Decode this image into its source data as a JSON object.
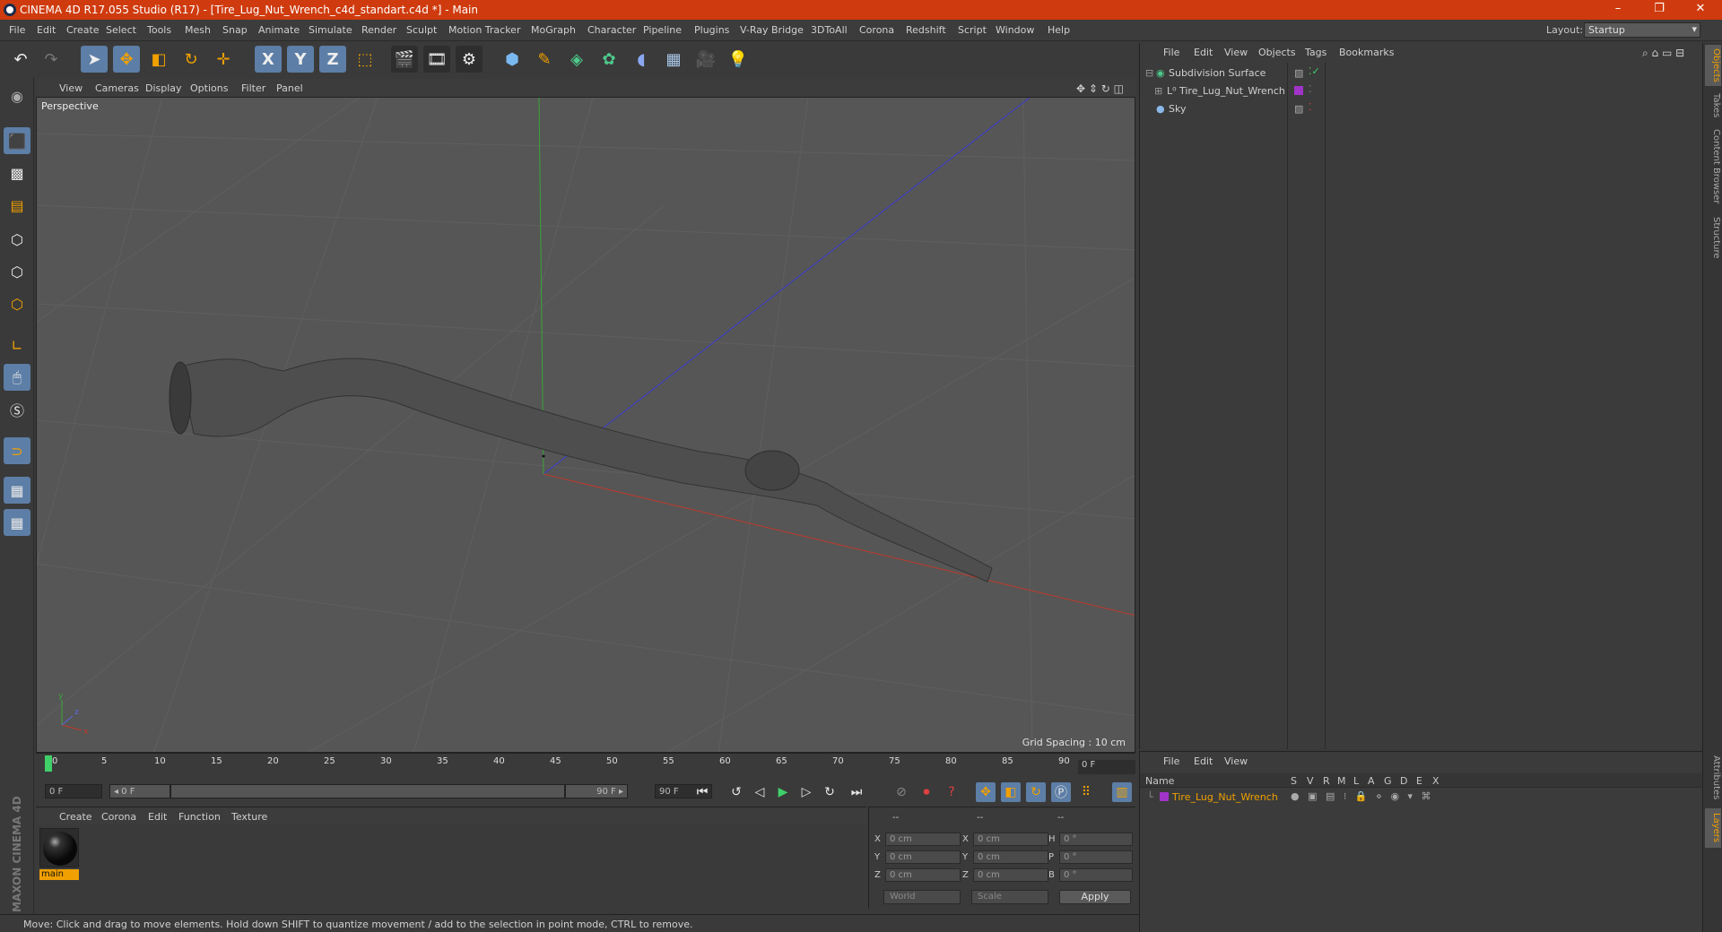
{
  "window": {
    "title": "CINEMA 4D R17.055 Studio (R17) - [Tire_Lug_Nut_Wrench_c4d_standart.c4d *] - Main",
    "controls": [
      "–",
      "❐",
      "✕"
    ]
  },
  "menubar": {
    "items": [
      "File",
      "Edit",
      "Create",
      "Select",
      "Tools",
      "Mesh",
      "Snap",
      "Animate",
      "Simulate",
      "Render",
      "Sculpt",
      "Motion Tracker",
      "MoGraph",
      "Character",
      "Pipeline",
      "Plugins",
      "V-Ray Bridge",
      "3DToAll",
      "Corona",
      "Redshift",
      "Script",
      "Window",
      "Help"
    ],
    "layout_label": "Layout:",
    "layout_value": "Startup"
  },
  "toolbar": {
    "icons": [
      "undo-icon",
      "redo-icon",
      "select-arrow-icon",
      "move-icon",
      "scale-icon",
      "rotate-icon",
      "live-select-icon",
      "x-axis-icon",
      "y-axis-icon",
      "z-axis-icon",
      "coordinate-system-icon",
      "render-view-icon",
      "render-picture-viewer-icon",
      "render-settings-icon",
      "cube-icon",
      "pen-icon",
      "subdivision-icon",
      "cloner-icon",
      "deformer-icon",
      "floor-icon",
      "camera-icon",
      "light-icon"
    ],
    "axis_x": "X",
    "axis_y": "Y",
    "axis_z": "Z"
  },
  "viewport": {
    "menu": [
      "View",
      "Cameras",
      "Display",
      "Options",
      "Filter",
      "Panel"
    ],
    "label": "Perspective",
    "grid_spacing": "Grid Spacing : 10 cm",
    "axis_colors": {
      "x": "#c0392b",
      "y": "#3aa53a",
      "z": "#3b3bd0"
    }
  },
  "timeline": {
    "ticks": [
      "0",
      "5",
      "10",
      "15",
      "20",
      "25",
      "30",
      "35",
      "40",
      "45",
      "50",
      "55",
      "60",
      "65",
      "70",
      "75",
      "80",
      "85",
      "90"
    ],
    "current_frame": "0 F"
  },
  "transport": {
    "start_field": "0 F",
    "range_left": "◂ 0 F",
    "range_right": "90 F ▸",
    "end_field": "90 F"
  },
  "material_manager": {
    "menu": [
      "Create",
      "Corona",
      "Edit",
      "Function",
      "Texture"
    ],
    "materials": [
      {
        "name": "main"
      }
    ]
  },
  "coordinates": {
    "headers": [
      "--",
      "--",
      "--"
    ],
    "rows": [
      {
        "axis": "X",
        "pos": "0 cm",
        "axis2": "X",
        "size": "0 cm",
        "rot_label": "H",
        "rot": "0 °"
      },
      {
        "axis": "Y",
        "pos": "0 cm",
        "axis2": "Y",
        "size": "0 cm",
        "rot_label": "P",
        "rot": "0 °"
      },
      {
        "axis": "Z",
        "pos": "0 cm",
        "axis2": "Z",
        "size": "0 cm",
        "rot_label": "B",
        "rot": "0 °"
      }
    ],
    "mode1": "World",
    "mode2": "Scale",
    "apply": "Apply"
  },
  "statusbar": {
    "text": "Move: Click and drag to move elements. Hold down SHIFT to quantize movement / add to the selection in point mode, CTRL to remove."
  },
  "object_manager": {
    "menu": [
      "File",
      "Edit",
      "View",
      "Objects",
      "Tags",
      "Bookmarks"
    ],
    "objects": [
      {
        "name": "Subdivision Surface",
        "icon": "subdivision-icon"
      },
      {
        "name": "Tire_Lug_Nut_Wrench",
        "icon": "null-object-icon"
      },
      {
        "name": "Sky",
        "icon": "sky-icon"
      }
    ]
  },
  "layer_manager": {
    "menu": [
      "File",
      "Edit",
      "View"
    ],
    "columns": [
      "Name",
      "S",
      "V",
      "R",
      "M",
      "L",
      "A",
      "G",
      "D",
      "E",
      "X"
    ],
    "layers": [
      {
        "name": "Tire_Lug_Nut_Wrench",
        "color": "#a033c8"
      }
    ]
  },
  "side_tabs": [
    "Objects",
    "Takes",
    "Content Browser",
    "Structure",
    "Attributes",
    "Layers"
  ],
  "brand": {
    "logo_text": "MAXON CINEMA 4D"
  }
}
